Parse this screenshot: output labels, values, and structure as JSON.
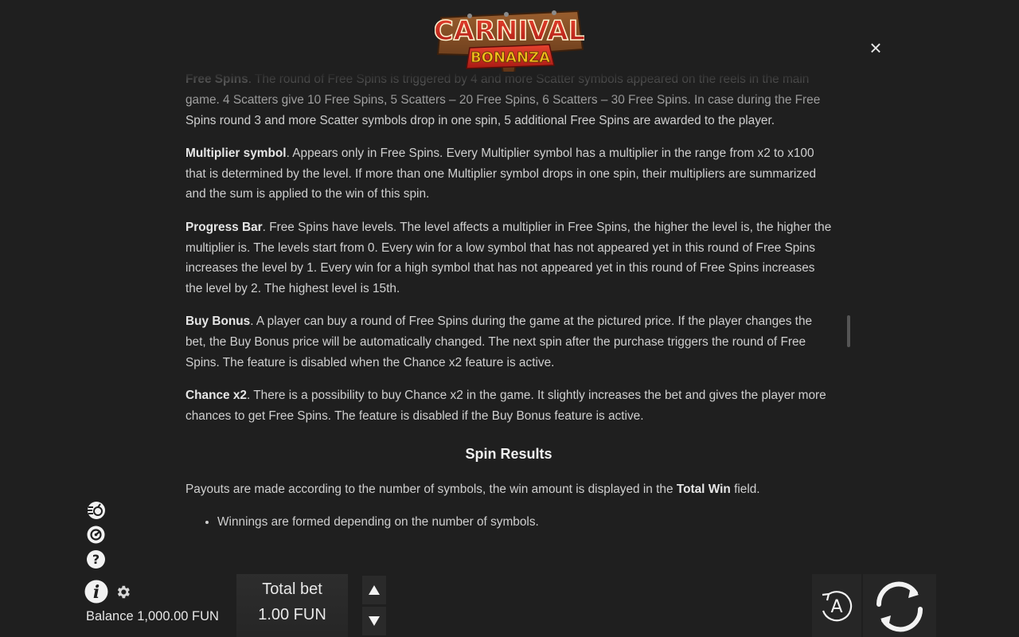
{
  "header": {
    "logo_line1": "CARNIVAL",
    "logo_line2": "BONANZA",
    "close_symbol": "×"
  },
  "rules": {
    "free_spins_title": "Free Spins",
    "free_spins_text": ". The round of Free Spins is triggered by 4 and more Scatter symbols appeared on the reels in the main game. 4 Scatters give 10 Free Spins, 5 Scatters – 20 Free Spins, 6 Scatters – 30 Free Spins. In case during the Free Spins round 3 and more Scatter symbols drop in one spin, 5 additional Free Spins are awarded to the player.",
    "multiplier_title": "Multiplier symbol",
    "multiplier_text": ". Appears only in Free Spins. Every Multiplier symbol has a multiplier in the range from x2 to x100 that is determined by the level. If more than one Multiplier symbol drops in one spin, their multipliers are summarized and the sum is applied to the win of this spin.",
    "progress_title": "Progress Bar",
    "progress_text": ". Free Spins have levels. The level affects a multiplier in Free Spins, the higher the level is, the higher the multiplier is. The levels start from 0. Every win for a low symbol that has not appeared yet in this round of Free Spins increases the level by 1. Every win for a high symbol that has not appeared yet in this round of Free Spins increases the level by 2. The highest level is 15th.",
    "buy_title": "Buy Bonus",
    "buy_text": ". A player can buy a round of Free Spins during the game at the pictured price. If the player changes the bet, the Buy Bonus price will be automatically changed. The next spin after the purchase triggers the round of Free Spins. The feature is disabled when the Chance x2 feature is active.",
    "chance_title": "Chance x2",
    "chance_text": ". There is a possibility to buy Chance x2 in the game. It slightly increases the bet and gives the player more chances to get Free Spins. The feature is disabled if the Buy Bonus feature is active.",
    "spin_results_title": "Spin Results",
    "payouts_text": "Payouts are made according to the number of symbols, the win amount is displayed in the ",
    "payouts_bold": "Total Win",
    "payouts_end": " field.",
    "bullet_1": "Winnings are formed depending on the number of symbols."
  },
  "footer": {
    "balance_label": "Balance",
    "balance_value": "1,000.00 FUN",
    "bet_label": "Total bet",
    "bet_value": "1.00 FUN",
    "auto_letter": "A"
  },
  "colors": {
    "background": "#1f1f1f",
    "logo_red": "#c7281e",
    "logo_yellow": "#f6c21c",
    "logo_wood": "#7a4a25"
  }
}
